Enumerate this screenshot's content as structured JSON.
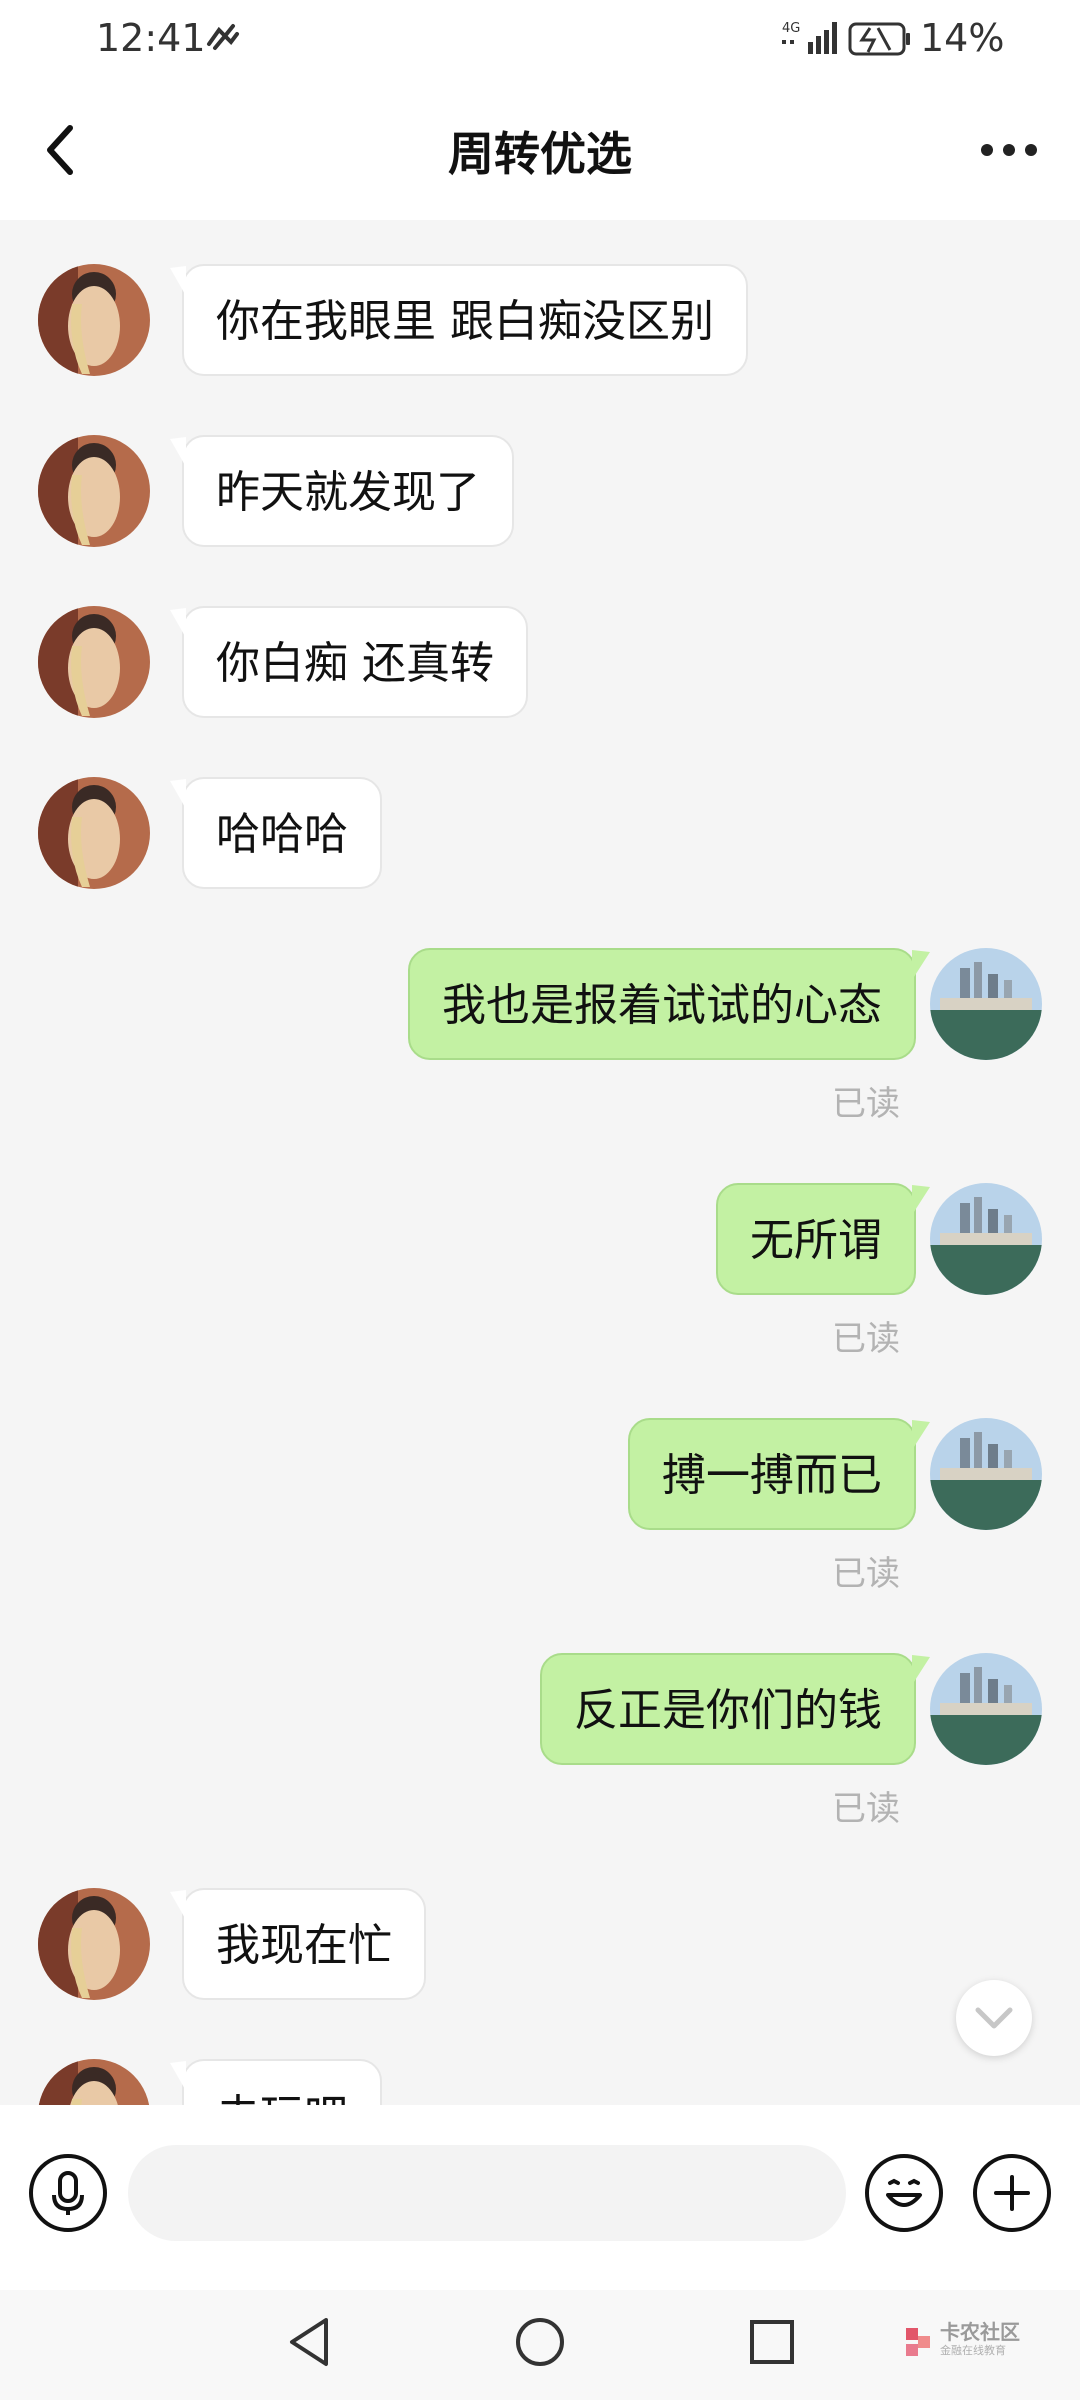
{
  "status_bar": {
    "time": "12:41",
    "network": "4G",
    "battery": "14%"
  },
  "header": {
    "title": "周转优选"
  },
  "messages": [
    {
      "side": "left",
      "text": "你在我眼里 跟白痴没区别"
    },
    {
      "side": "left",
      "text": "昨天就发现了"
    },
    {
      "side": "left",
      "text": "你白痴  还真转"
    },
    {
      "side": "left",
      "text": "哈哈哈"
    },
    {
      "side": "right",
      "text": "我也是报着试试的心态",
      "read": "已读"
    },
    {
      "side": "right",
      "text": "无所谓",
      "read": "已读"
    },
    {
      "side": "right",
      "text": "搏一搏而已",
      "read": "已读"
    },
    {
      "side": "right",
      "text": "反正是你们的钱",
      "read": "已读"
    },
    {
      "side": "left",
      "text": "我现在忙"
    },
    {
      "side": "left",
      "text": "去玩吧"
    }
  ],
  "input": {
    "placeholder": ""
  },
  "watermark": {
    "title": "卡农社区",
    "subtitle": "金融在线教育"
  },
  "colors": {
    "sent_bubble": "#c3f1a3",
    "received_bubble": "#ffffff",
    "read_label": "#b3b3b3",
    "background": "#f5f5f5"
  }
}
